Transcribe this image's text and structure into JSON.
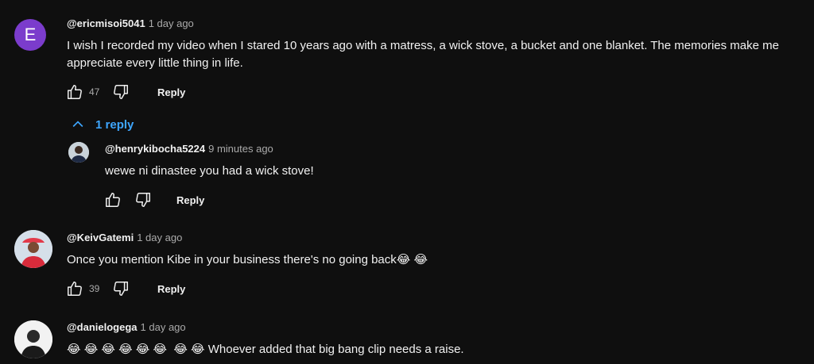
{
  "comments": [
    {
      "author": "@ericmisoi5041",
      "time": "1 day ago",
      "avatar_letter": "E",
      "text": "I wish I recorded my video when I stared 10 years ago with a matress, a wick stove, a bucket and one blanket. The memories make me appreciate every little thing in life.",
      "likes": "47",
      "reply_label": "Reply",
      "replies_toggle": "1 reply",
      "replies": [
        {
          "author": "@henrykibocha5224",
          "time": "9 minutes ago",
          "text": "wewe ni dinastee you had a wick stove!",
          "reply_label": "Reply"
        }
      ]
    },
    {
      "author": "@KeivGatemi",
      "time": "1 day ago",
      "text": "Once you mention Kibe in your business there's no going back😂 😂",
      "likes": "39",
      "reply_label": "Reply"
    },
    {
      "author": "@danielogega",
      "time": "1 day ago",
      "text": "😂 😂 😂 😂 😂 😂  😂 😂 Whoever added that big bang clip needs a raise."
    }
  ],
  "colors": {
    "background": "#0f0f0f",
    "link": "#3ea6ff",
    "avatar_e": "#7b3ccc",
    "secondary_text": "#aaaaaa"
  },
  "icons": [
    "like-icon",
    "dislike-icon",
    "chevron-up-icon"
  ]
}
